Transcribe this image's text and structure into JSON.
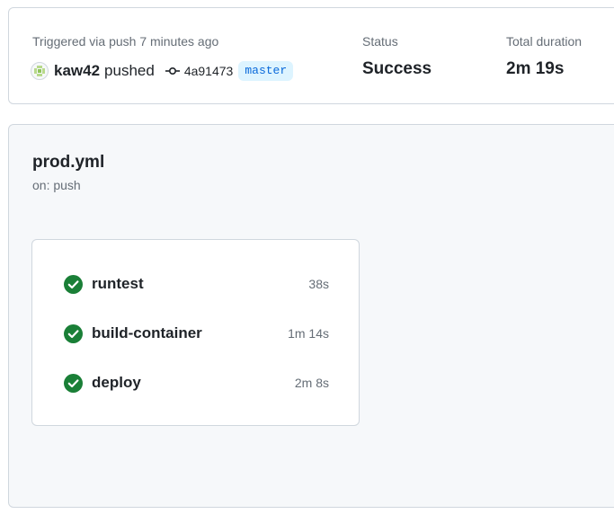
{
  "summary": {
    "trigger_text": "Triggered via push 7 minutes ago",
    "actor": "kaw42",
    "action": "pushed",
    "commit_sha": "4a91473",
    "branch": "master",
    "status_label": "Status",
    "status_value": "Success",
    "duration_label": "Total duration",
    "duration_value": "2m 19s"
  },
  "workflow": {
    "name": "prod.yml",
    "trigger": "on: push",
    "jobs": [
      {
        "name": "runtest",
        "duration": "38s",
        "status": "success"
      },
      {
        "name": "build-container",
        "duration": "1m 14s",
        "status": "success"
      },
      {
        "name": "deploy",
        "duration": "2m 8s",
        "status": "success"
      }
    ]
  },
  "colors": {
    "success": "#1a7f37",
    "link": "#0969da",
    "badge_bg": "#ddf4ff",
    "panel_bg": "#f6f8fa",
    "border": "#d0d7de"
  },
  "icons": {
    "avatar": "identicon-avatar",
    "commit": "git-commit-icon",
    "job_status": "check-circle-fill-icon"
  }
}
